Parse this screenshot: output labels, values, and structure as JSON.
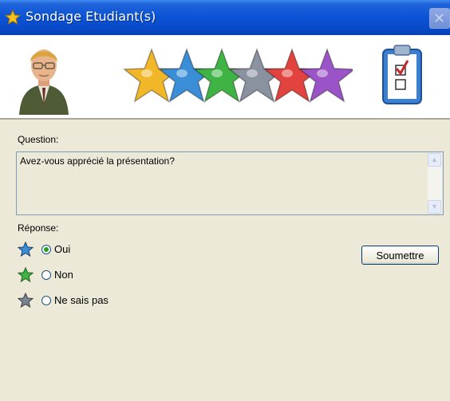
{
  "window": {
    "title": "Sondage Etudiant(s)",
    "title_icon": "star-icon",
    "close_icon": "close-icon"
  },
  "banner": {
    "left_image": "teacher-avatar-icon",
    "center_image": "rating-stars-icon",
    "right_image": "checklist-clipboard-icon",
    "star_colors": [
      "#f2b629",
      "#3a8ed8",
      "#3fb444",
      "#8a92a0",
      "#e2433e",
      "#9b54c8"
    ]
  },
  "question": {
    "label": "Question:",
    "text": "Avez-vous apprécié la présentation?",
    "scroll_up_icon": "scroll-up-icon",
    "scroll_down_icon": "scroll-down-icon"
  },
  "response": {
    "label": "Réponse:",
    "options": [
      {
        "label": "Oui",
        "checked": true,
        "star_color": "#3a8ed8"
      },
      {
        "label": "Non",
        "checked": false,
        "star_color": "#3fb444"
      },
      {
        "label": "Ne sais pas",
        "checked": false,
        "star_color": "#7c8494"
      }
    ]
  },
  "actions": {
    "submit_label": "Soumettre"
  }
}
